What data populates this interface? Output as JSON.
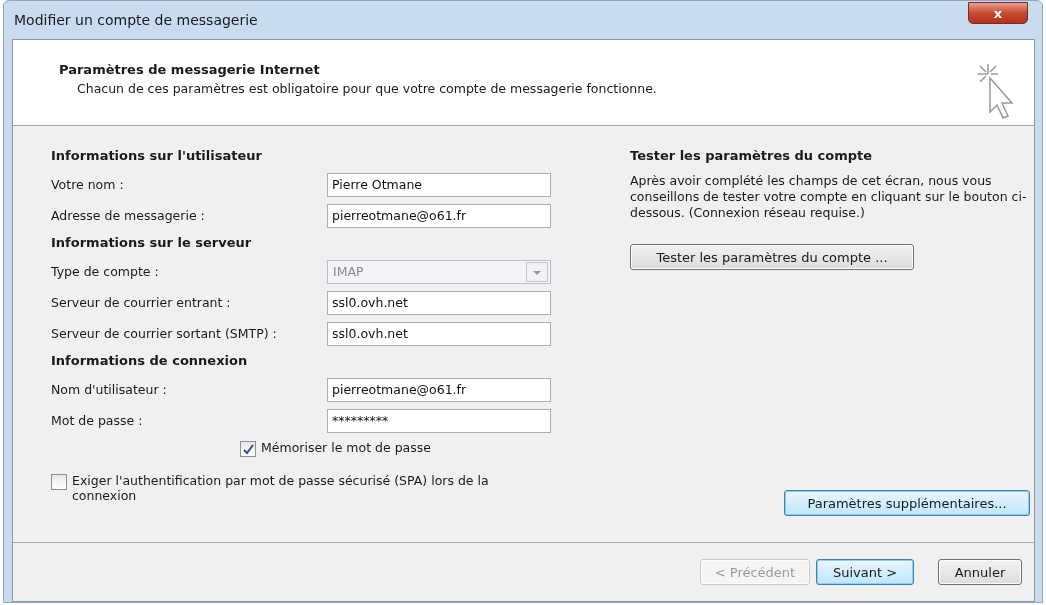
{
  "window": {
    "title": "Modifier un compte de messagerie",
    "close": "x"
  },
  "header": {
    "title": "Paramètres de messagerie Internet",
    "subtitle": "Chacun de ces paramètres est obligatoire pour que votre compte de messagerie fonctionne."
  },
  "sections": [
    {
      "heading": "Informations sur l'utilisateur",
      "fields": [
        {
          "kind": "text",
          "label": "Votre nom :",
          "value": "Pierre Otmane"
        },
        {
          "kind": "text",
          "label": "Adresse de messagerie :",
          "value": "pierreotmane@o61.fr"
        }
      ]
    },
    {
      "heading": "Informations sur le serveur",
      "fields": [
        {
          "kind": "dropdown",
          "label": "Type de compte :",
          "value": "IMAP",
          "disabled": true
        },
        {
          "kind": "text",
          "label": "Serveur de courrier entrant :",
          "value": "ssl0.ovh.net"
        },
        {
          "kind": "text",
          "label": "Serveur de courrier sortant (SMTP) :",
          "value": "ssl0.ovh.net"
        }
      ]
    },
    {
      "heading": "Informations de connexion",
      "fields": [
        {
          "kind": "text",
          "label": "Nom d'utilisateur :",
          "value": "pierreotmane@o61.fr"
        },
        {
          "kind": "text",
          "label": "Mot de passe :",
          "value": "*********"
        }
      ]
    }
  ],
  "remember_password": {
    "label": "Mémoriser le mot de passe",
    "checked": true
  },
  "spa": {
    "label": "Exiger l'authentification par mot de passe sécurisé (SPA) lors de la connexion",
    "checked": false
  },
  "test": {
    "heading": "Tester les paramètres du compte",
    "text": "Après avoir complété les champs de cet écran, nous vous conseillons de tester votre compte en cliquant sur le bouton ci-dessous. (Connexion réseau requise.)",
    "button": "Tester les paramètres du compte ..."
  },
  "more_settings": {
    "label": "Paramètres supplémentaires...",
    "focused": true
  },
  "buttons": [
    {
      "label": "< Précédent",
      "disabled": true,
      "default": false
    },
    {
      "label": "Suivant >",
      "disabled": false,
      "default": true
    },
    {
      "label": "Annuler",
      "disabled": false,
      "default": false
    }
  ]
}
